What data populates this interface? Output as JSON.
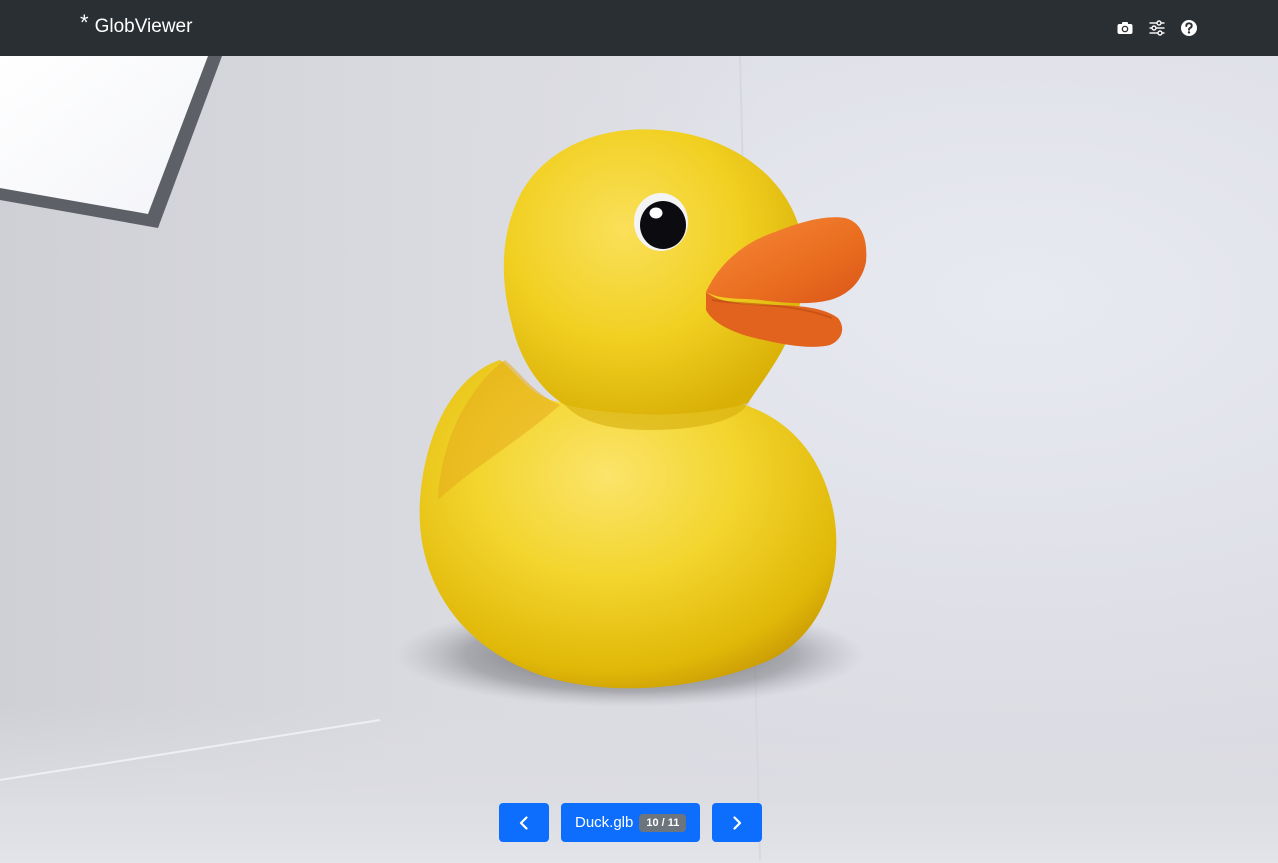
{
  "app": {
    "star": "*",
    "title": "GlobViewer"
  },
  "toolbar": {
    "icons": [
      "camera-icon",
      "sliders-icon",
      "help-icon"
    ]
  },
  "viewer": {
    "model_file": "Duck.glb",
    "counter": "10 / 11"
  },
  "colors": {
    "topbar": "#2a2f34",
    "accent": "#0d6efd",
    "badge": "#6c757d",
    "duck_body": "#f2d22c",
    "duck_beak": "#ee7428"
  }
}
